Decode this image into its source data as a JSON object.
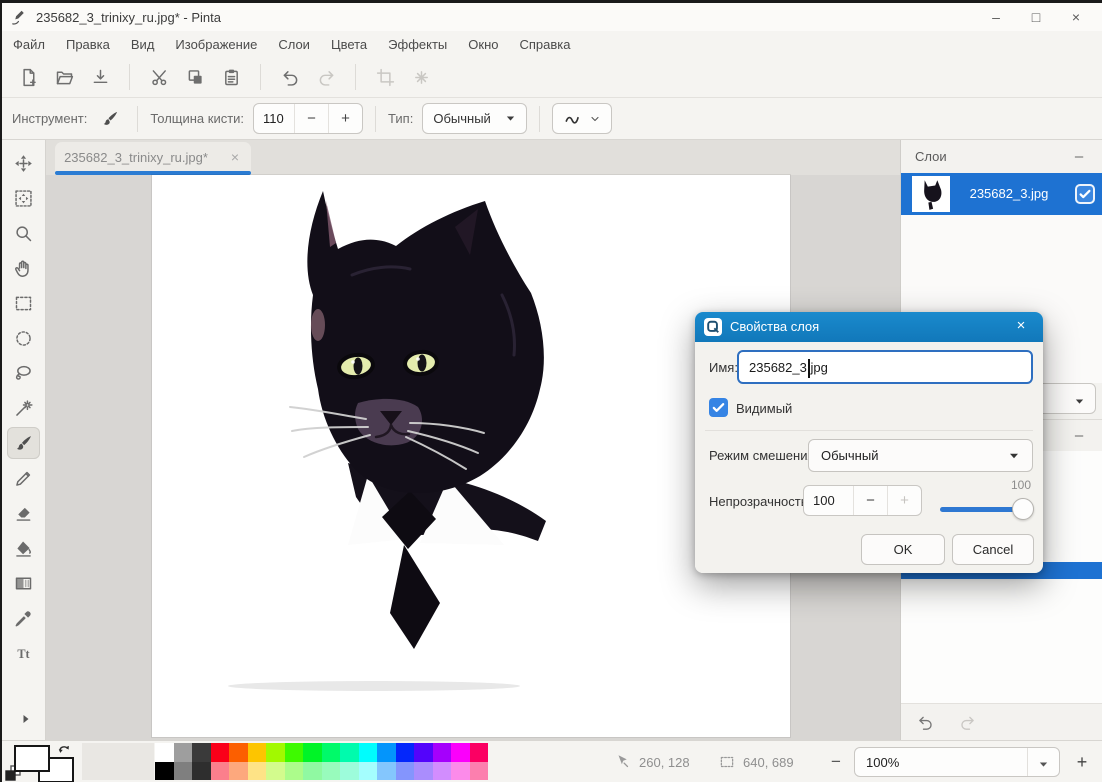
{
  "window": {
    "title": "235682_3_trinixy_ru.jpg* - Pinta",
    "minimize_glyph": "–",
    "maximize_glyph": "□",
    "close_glyph": "×"
  },
  "menubar": {
    "items": [
      "Файл",
      "Правка",
      "Вид",
      "Изображение",
      "Слои",
      "Цвета",
      "Эффекты",
      "Окно",
      "Справка"
    ]
  },
  "toolbar": {
    "groups": [
      [
        {
          "name": "new-image",
          "icon": "new-image-icon",
          "enabled": true
        },
        {
          "name": "open-image",
          "icon": "open-icon",
          "enabled": true
        },
        {
          "name": "save",
          "icon": "save-icon",
          "enabled": true
        }
      ],
      [
        {
          "name": "cut",
          "icon": "cut-icon",
          "enabled": true
        },
        {
          "name": "copy",
          "icon": "copy-icon",
          "enabled": true
        },
        {
          "name": "paste",
          "icon": "paste-icon",
          "enabled": true
        }
      ],
      [
        {
          "name": "undo",
          "icon": "undo-icon",
          "enabled": true
        },
        {
          "name": "redo",
          "icon": "redo-icon",
          "enabled": false
        }
      ],
      [
        {
          "name": "crop-to-selection",
          "icon": "crop-icon",
          "enabled": false
        },
        {
          "name": "deselect",
          "icon": "deselect-icon",
          "enabled": false
        }
      ]
    ]
  },
  "tool_options": {
    "tool_label": "Инструмент:",
    "tool_icon": "paintbrush-icon",
    "brush_width_label": "Толщина кисти:",
    "brush_width_value": "110",
    "minus_glyph": "−",
    "plus_glyph": "+",
    "type_label": "Тип:",
    "type_value": "Обычный",
    "stroke_style_icon": "squiggle-icon"
  },
  "toolbox": {
    "tools": [
      {
        "name": "move-selection",
        "icon": "move-arrows-icon",
        "active": false
      },
      {
        "name": "move-selected",
        "icon": "move-selected-icon",
        "active": false
      },
      {
        "name": "zoom",
        "icon": "magnifier-icon",
        "active": false
      },
      {
        "name": "pan",
        "icon": "hand-icon",
        "active": false
      },
      {
        "name": "rectangle-select",
        "icon": "rectangle-select-icon",
        "active": false
      },
      {
        "name": "ellipse-select",
        "icon": "ellipse-select-icon",
        "active": false
      },
      {
        "name": "lasso-select",
        "icon": "lasso-icon",
        "active": false
      },
      {
        "name": "magic-wand",
        "icon": "magic-wand-icon",
        "active": false
      },
      {
        "name": "paintbrush",
        "icon": "paintbrush-icon",
        "active": true
      },
      {
        "name": "pencil",
        "icon": "pencil-icon",
        "active": false
      },
      {
        "name": "eraser",
        "icon": "eraser-icon",
        "active": false
      },
      {
        "name": "paint-bucket",
        "icon": "paint-bucket-icon",
        "active": false
      },
      {
        "name": "gradient",
        "icon": "gradient-icon",
        "active": false
      },
      {
        "name": "color-picker",
        "icon": "eyedropper-icon",
        "active": false
      },
      {
        "name": "text",
        "icon": "text-icon",
        "active": false
      }
    ]
  },
  "document_tab": {
    "label": "235682_3_trinixy_ru.jpg*",
    "close_glyph": "×"
  },
  "layers_panel": {
    "title": "Слои",
    "minimize_glyph": "–",
    "layers": [
      {
        "name": "235682_3.jpg",
        "visible": true
      }
    ]
  },
  "history_panel": {
    "minimize_glyph": "–"
  },
  "dialog": {
    "title": "Свойства слоя",
    "close_glyph": "×",
    "name_label": "Имя:",
    "name_value": "235682_3.jpg",
    "visible_label": "Видимый",
    "visible_checked": true,
    "blend_label": "Режим смешения:",
    "blend_value": "Обычный",
    "opacity_label": "Непрозрачность:",
    "opacity_value": "100",
    "opacity_slider_value": "100",
    "minus_glyph": "−",
    "plus_glyph": "+",
    "ok_label": "OK",
    "cancel_label": "Cancel"
  },
  "statusbar": {
    "cursor_position": "260, 128",
    "selection_size": "640, 689",
    "zoom_value": "100%",
    "minus_glyph": "−",
    "plus_glyph": "+"
  },
  "palette": {
    "primary_color": "#ffffff",
    "secondary_color": "#ffffff",
    "columns": [
      [
        "#ffffff",
        "#000000"
      ],
      [
        "#9e9e9e",
        "#7f7f7f"
      ],
      [
        "#3a3a3a",
        "#2e2e2e"
      ],
      [
        "#fa0019",
        "#fb7f8c"
      ],
      [
        "#fc5f00",
        "#fda87d"
      ],
      [
        "#fdc500",
        "#fee386"
      ],
      [
        "#a2f900",
        "#d3fb8d"
      ],
      [
        "#3efa00",
        "#acfc8b"
      ],
      [
        "#00f427",
        "#90f9a2"
      ],
      [
        "#00fa69",
        "#98fbbc"
      ],
      [
        "#00fbad",
        "#9dfcdb"
      ],
      [
        "#00fdfd",
        "#a4fefe"
      ],
      [
        "#0495fb",
        "#84c6fd"
      ],
      [
        "#0427fb",
        "#8495fd"
      ],
      [
        "#5304fb",
        "#aa8dfd"
      ],
      [
        "#a500fc",
        "#d28dfe"
      ],
      [
        "#fb00fb",
        "#fc8bea"
      ],
      [
        "#fb0063",
        "#fc7fae"
      ]
    ]
  },
  "colors": {
    "accent_blue": "#2b7cd3",
    "selection_blue": "#1e72d2",
    "dialog_titlebar_blue": "#1584cb",
    "control_blue": "#3584e4",
    "canvas_bg": "#d8d6d3",
    "chrome_bg": "#f5f4f1"
  }
}
